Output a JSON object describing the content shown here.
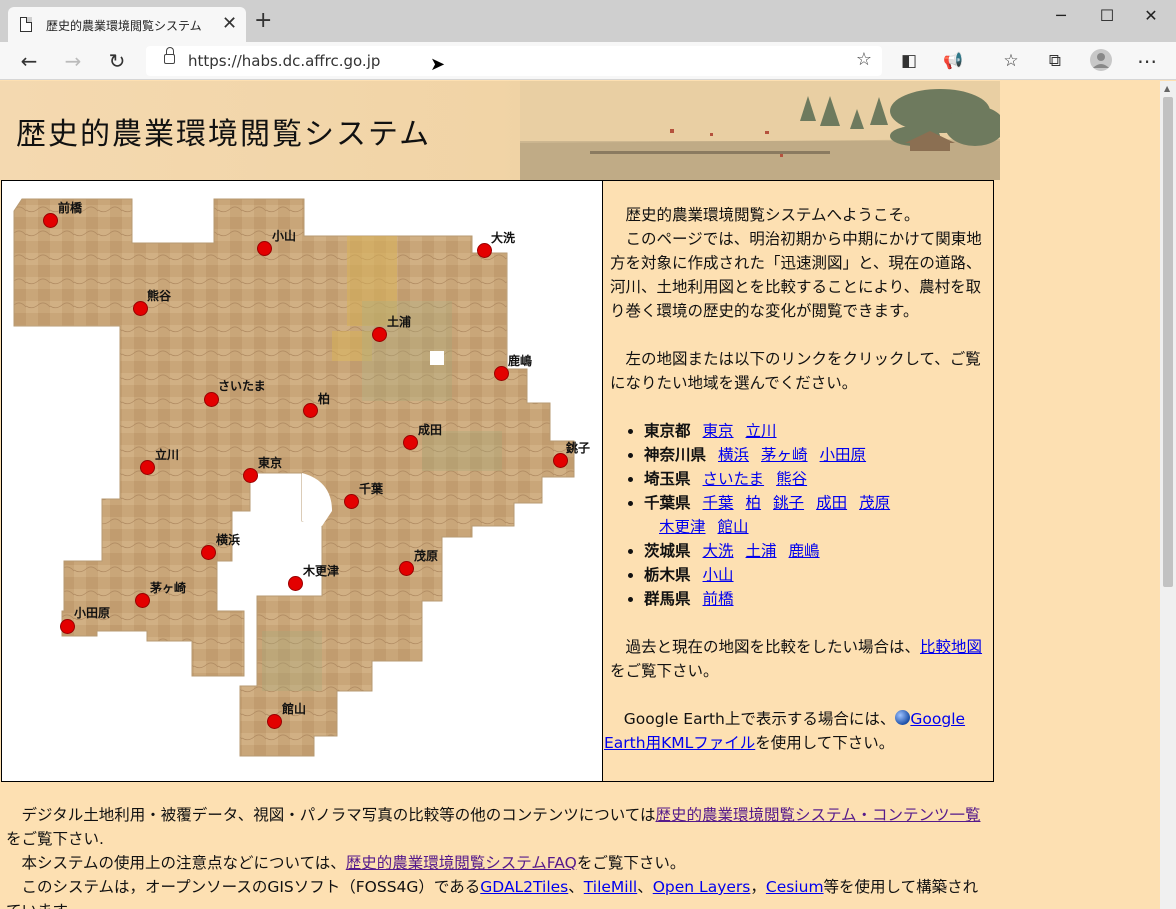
{
  "browser": {
    "tab_title": "歴史的農業環境閲覧システム",
    "url": "https://habs.dc.affrc.go.jp"
  },
  "banner": {
    "title": "歴史的農業環境閲覧システム"
  },
  "map": {
    "markers": [
      {
        "id": "maebashi",
        "label": "前橋"
      },
      {
        "id": "oyama",
        "label": "小山"
      },
      {
        "id": "oarai",
        "label": "大洗"
      },
      {
        "id": "kumagaya",
        "label": "熊谷"
      },
      {
        "id": "tsuchiura",
        "label": "土浦"
      },
      {
        "id": "kashima",
        "label": "鹿嶋"
      },
      {
        "id": "saitama",
        "label": "さいたま"
      },
      {
        "id": "kashiwa",
        "label": "柏"
      },
      {
        "id": "narita",
        "label": "成田"
      },
      {
        "id": "choshi",
        "label": "銚子"
      },
      {
        "id": "tachikawa",
        "label": "立川"
      },
      {
        "id": "tokyo",
        "label": "東京"
      },
      {
        "id": "chiba",
        "label": "千葉"
      },
      {
        "id": "yokohama",
        "label": "横浜"
      },
      {
        "id": "kisarazu",
        "label": "木更津"
      },
      {
        "id": "mobara",
        "label": "茂原"
      },
      {
        "id": "chigasaki",
        "label": "茅ヶ崎"
      },
      {
        "id": "odawara",
        "label": "小田原"
      },
      {
        "id": "tateyama",
        "label": "館山"
      }
    ]
  },
  "intro": {
    "welcome": "歴史的農業環境閲覧システムへようこそ。",
    "description": "このページでは、明治初期から中期にかけて関東地方を対象に作成された「迅速測図」と、現在の道路、河川、土地利用図とを比較することにより、農村を取り巻く環境の歴史的な変化が閲覧できます。",
    "instruction": "左の地図または以下のリンクをクリックして、ご覧になりたい地域を選んでください。"
  },
  "regions": [
    {
      "pref": "東京都",
      "cities": [
        "東京",
        "立川"
      ]
    },
    {
      "pref": "神奈川県",
      "cities": [
        "横浜",
        "茅ヶ崎",
        "小田原"
      ]
    },
    {
      "pref": "埼玉県",
      "cities": [
        "さいたま",
        "熊谷"
      ]
    },
    {
      "pref": "千葉県",
      "cities": [
        "千葉",
        "柏",
        "銚子",
        "成田",
        "茂原",
        "木更津",
        "館山"
      ]
    },
    {
      "pref": "茨城県",
      "cities": [
        "大洗",
        "土浦",
        "鹿嶋"
      ]
    },
    {
      "pref": "栃木県",
      "cities": [
        "小山"
      ]
    },
    {
      "pref": "群馬県",
      "cities": [
        "前橋"
      ]
    }
  ],
  "compare": {
    "prefix": "過去と現在の地図を比較をしたい場合は、",
    "link": "比較地図",
    "suffix": "をご覧下さい。"
  },
  "google_earth": {
    "prefix": "Google Earth上で表示する場合には、",
    "link": "Google Earth用KMLファイル",
    "suffix": "を使用して下さい。"
  },
  "footer": {
    "line1_prefix": "デジタル土地利用・被覆データ、視図・パノラマ写真の比較等の他のコンテンツについては",
    "line1_link": "歴史的農業環境閲覧システム・コンテンツ一覧",
    "line1_suffix": "をご覧下さい.",
    "line2_prefix": "本システムの使用上の注意点などについては、",
    "line2_link": "歴史的農業環境閲覧システムFAQ",
    "line2_suffix": "をご覧下さい。",
    "line3_prefix": "このシステムは，オープンソースのGISソフト（FOSS4G）である",
    "line3_links": [
      "GDAL2Tiles",
      "TileMill",
      "Open Layers",
      "Cesium"
    ],
    "line3_suffix": "等を使用して構築されています。"
  }
}
